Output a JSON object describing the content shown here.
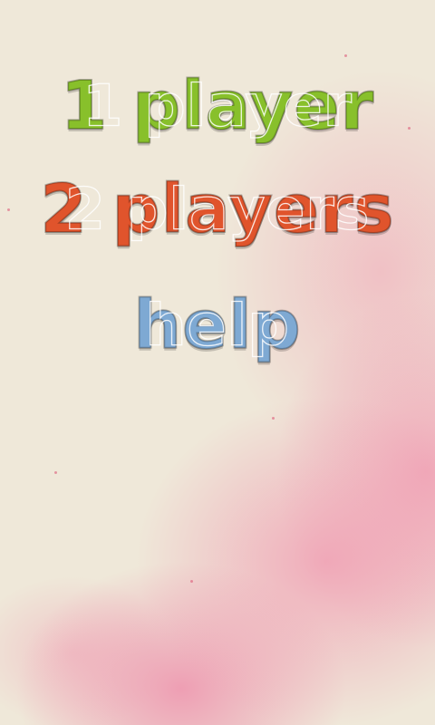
{
  "menu": {
    "items": [
      {
        "label": "1 player",
        "color": "#88c02b"
      },
      {
        "label": "2 players",
        "color": "#e0542c"
      },
      {
        "label": "help",
        "color": "#7ea9d3"
      }
    ]
  },
  "theme": {
    "background": "#efe8d9",
    "splash_color": "#f0a0b4"
  }
}
